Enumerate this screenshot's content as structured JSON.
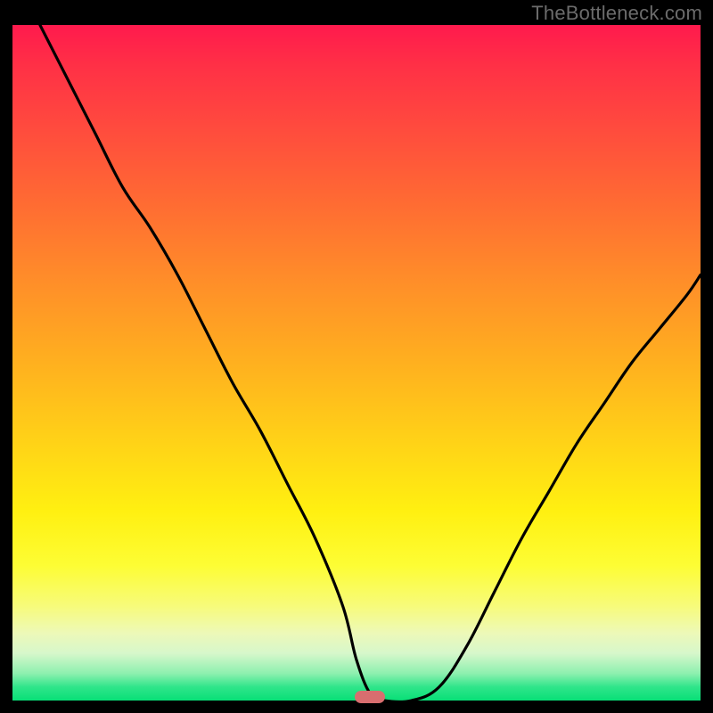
{
  "watermark": "TheBottleneck.com",
  "colors": {
    "curve_stroke": "#000000",
    "marker_fill": "#d86e6f",
    "gradient_top": "#ff1a4d",
    "gradient_bottom": "#08df77"
  },
  "chart_data": {
    "type": "line",
    "title": "",
    "xlabel": "",
    "ylabel": "",
    "xlim": [
      0,
      100
    ],
    "ylim": [
      0,
      100
    ],
    "x": [
      4,
      8,
      12,
      16,
      20,
      24,
      28,
      32,
      36,
      40,
      44,
      48,
      50,
      52,
      54,
      58,
      62,
      66,
      70,
      74,
      78,
      82,
      86,
      90,
      94,
      98,
      100
    ],
    "values": [
      100,
      92,
      84,
      76,
      70,
      63,
      55,
      47,
      40,
      32,
      24,
      14,
      6,
      1,
      0,
      0,
      2,
      8,
      16,
      24,
      31,
      38,
      44,
      50,
      55,
      60,
      63
    ],
    "marker": {
      "x": 52,
      "y": 0.5
    },
    "grid": false,
    "legend": false
  }
}
